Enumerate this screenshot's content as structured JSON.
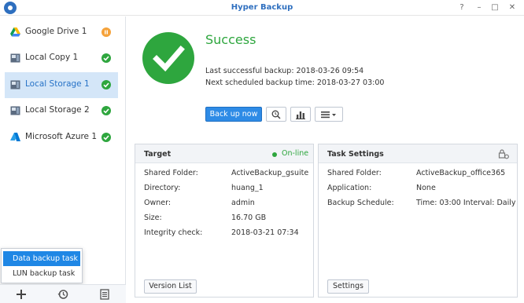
{
  "window": {
    "title": "Hyper Backup",
    "controls": [
      "?",
      "–",
      "□",
      "✕"
    ]
  },
  "sidebar": {
    "items": [
      {
        "label": "Google Drive 1",
        "icon": "google-drive-icon",
        "status": "warning"
      },
      {
        "label": "Local Copy 1",
        "icon": "local-copy-icon",
        "status": "success"
      },
      {
        "label": "Local Storage 1",
        "icon": "local-storage-icon",
        "status": "success",
        "active": true
      },
      {
        "label": "Local Storage 2",
        "icon": "local-storage-icon",
        "status": "success"
      },
      {
        "label": "Microsoft Azure 1",
        "icon": "azure-icon",
        "status": "success"
      }
    ],
    "popup": [
      "Data backup task",
      "LUN backup task"
    ]
  },
  "status": {
    "title": "Success",
    "last_backup": "Last successful backup: 2018-03-26 09:54",
    "next_backup": "Next scheduled backup time: 2018-03-27 03:00"
  },
  "toolbar": {
    "backup_label": "Back up now"
  },
  "target": {
    "title": "Target",
    "online": "On-line",
    "rows": [
      {
        "key": "Shared Folder:",
        "value": "ActiveBackup_gsuite"
      },
      {
        "key": "Directory:",
        "value": "huang_1"
      },
      {
        "key": "Owner:",
        "value": "admin"
      },
      {
        "key": "Size:",
        "value": "16.70 GB"
      },
      {
        "key": "Integrity check:",
        "value": "2018-03-21 07:34"
      }
    ],
    "button": "Version List"
  },
  "task": {
    "title": "Task Settings",
    "rows": [
      {
        "key": "Shared Folder:",
        "value": "ActiveBackup_office365"
      },
      {
        "key": "Application:",
        "value": "None"
      },
      {
        "key": "Backup Schedule:",
        "value": "Time: 03:00 Interval: Daily"
      }
    ],
    "button": "Settings"
  },
  "colors": {
    "accent": "#2e8be6",
    "success": "#2ea63e",
    "warning": "#f5a23a",
    "title": "#2e6fbf"
  }
}
